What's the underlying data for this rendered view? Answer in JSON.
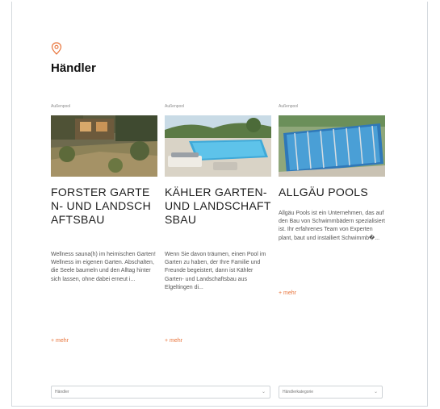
{
  "section": {
    "title": "Händler",
    "icon": "location-pin-icon"
  },
  "cards": [
    {
      "category": "Außenpool",
      "title": "FORSTER GARTEN- UND LANDSCHAFTSBAU",
      "text": "Wellness sauna(h) im heimischen Garten! Wellness im eigenen Garten. Abschalten, die Seele baumeln und den Alltag hinter sich lassen, ohne dabei erneut i...",
      "more": "+ mehr"
    },
    {
      "category": "Außenpool",
      "title": "KÄHLER GARTEN- UND LANDSCHAFTSBAU",
      "text": "Wenn Sie davon träumen, einen Pool im Garten zu haben, der Ihre Familie und Freunde begeistert, dann ist Kähler Garten- und Landschaftsbau aus Elgeltingen di...",
      "more": "+ mehr"
    },
    {
      "category": "Außenpool",
      "title": "ALLGÄU POOLS",
      "text": "Allgäu Pools ist ein Unternehmen, das auf den Bau von Schwimmbädern spezialisiert ist. Ihr erfahrenes Team von Experten plant, baut und installiert Schwimmb�...",
      "more": "+ mehr"
    }
  ],
  "filters": {
    "dealer": {
      "label": "Händler"
    },
    "dealer_category": {
      "label": "Händlerkategorie"
    }
  },
  "colors": {
    "accent": "#e8743b",
    "border": "#d4d9de"
  }
}
